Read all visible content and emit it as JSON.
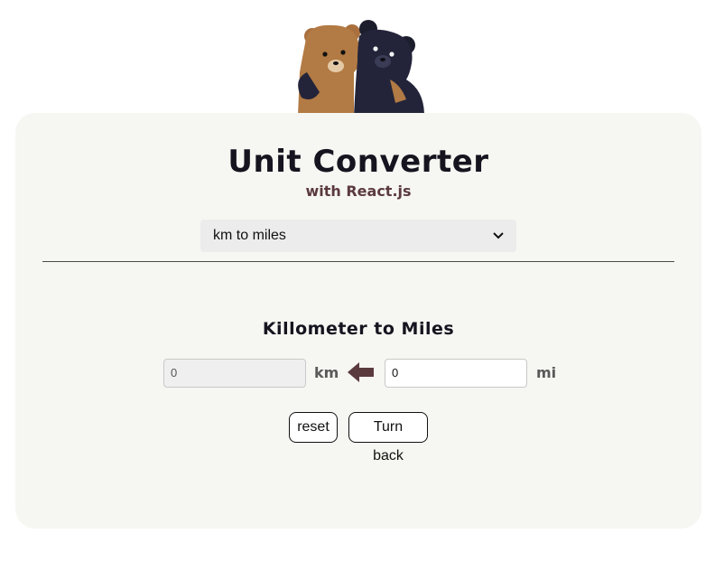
{
  "header": {
    "title": "Unit Converter",
    "subtitle": "with React.js",
    "logo": "two-bears-illustration"
  },
  "converter": {
    "select": {
      "selected": "km to miles",
      "icon": "chevron-down-icon"
    },
    "section_title": "Killometer to Miles",
    "left_input": {
      "value": "0",
      "unit": "km",
      "disabled": true
    },
    "right_input": {
      "value": "0",
      "unit": "mi"
    },
    "arrow_icon": "arrow-left-icon",
    "buttons": {
      "reset": "reset",
      "turn_back": "Turn back"
    }
  },
  "colors": {
    "page_bg": "#ffffff",
    "card_bg": "#f6f6f2",
    "title": "#15141f",
    "subtitle": "#5b3a3e",
    "arrow": "#5b3a3e",
    "select_bg": "#ececec"
  }
}
